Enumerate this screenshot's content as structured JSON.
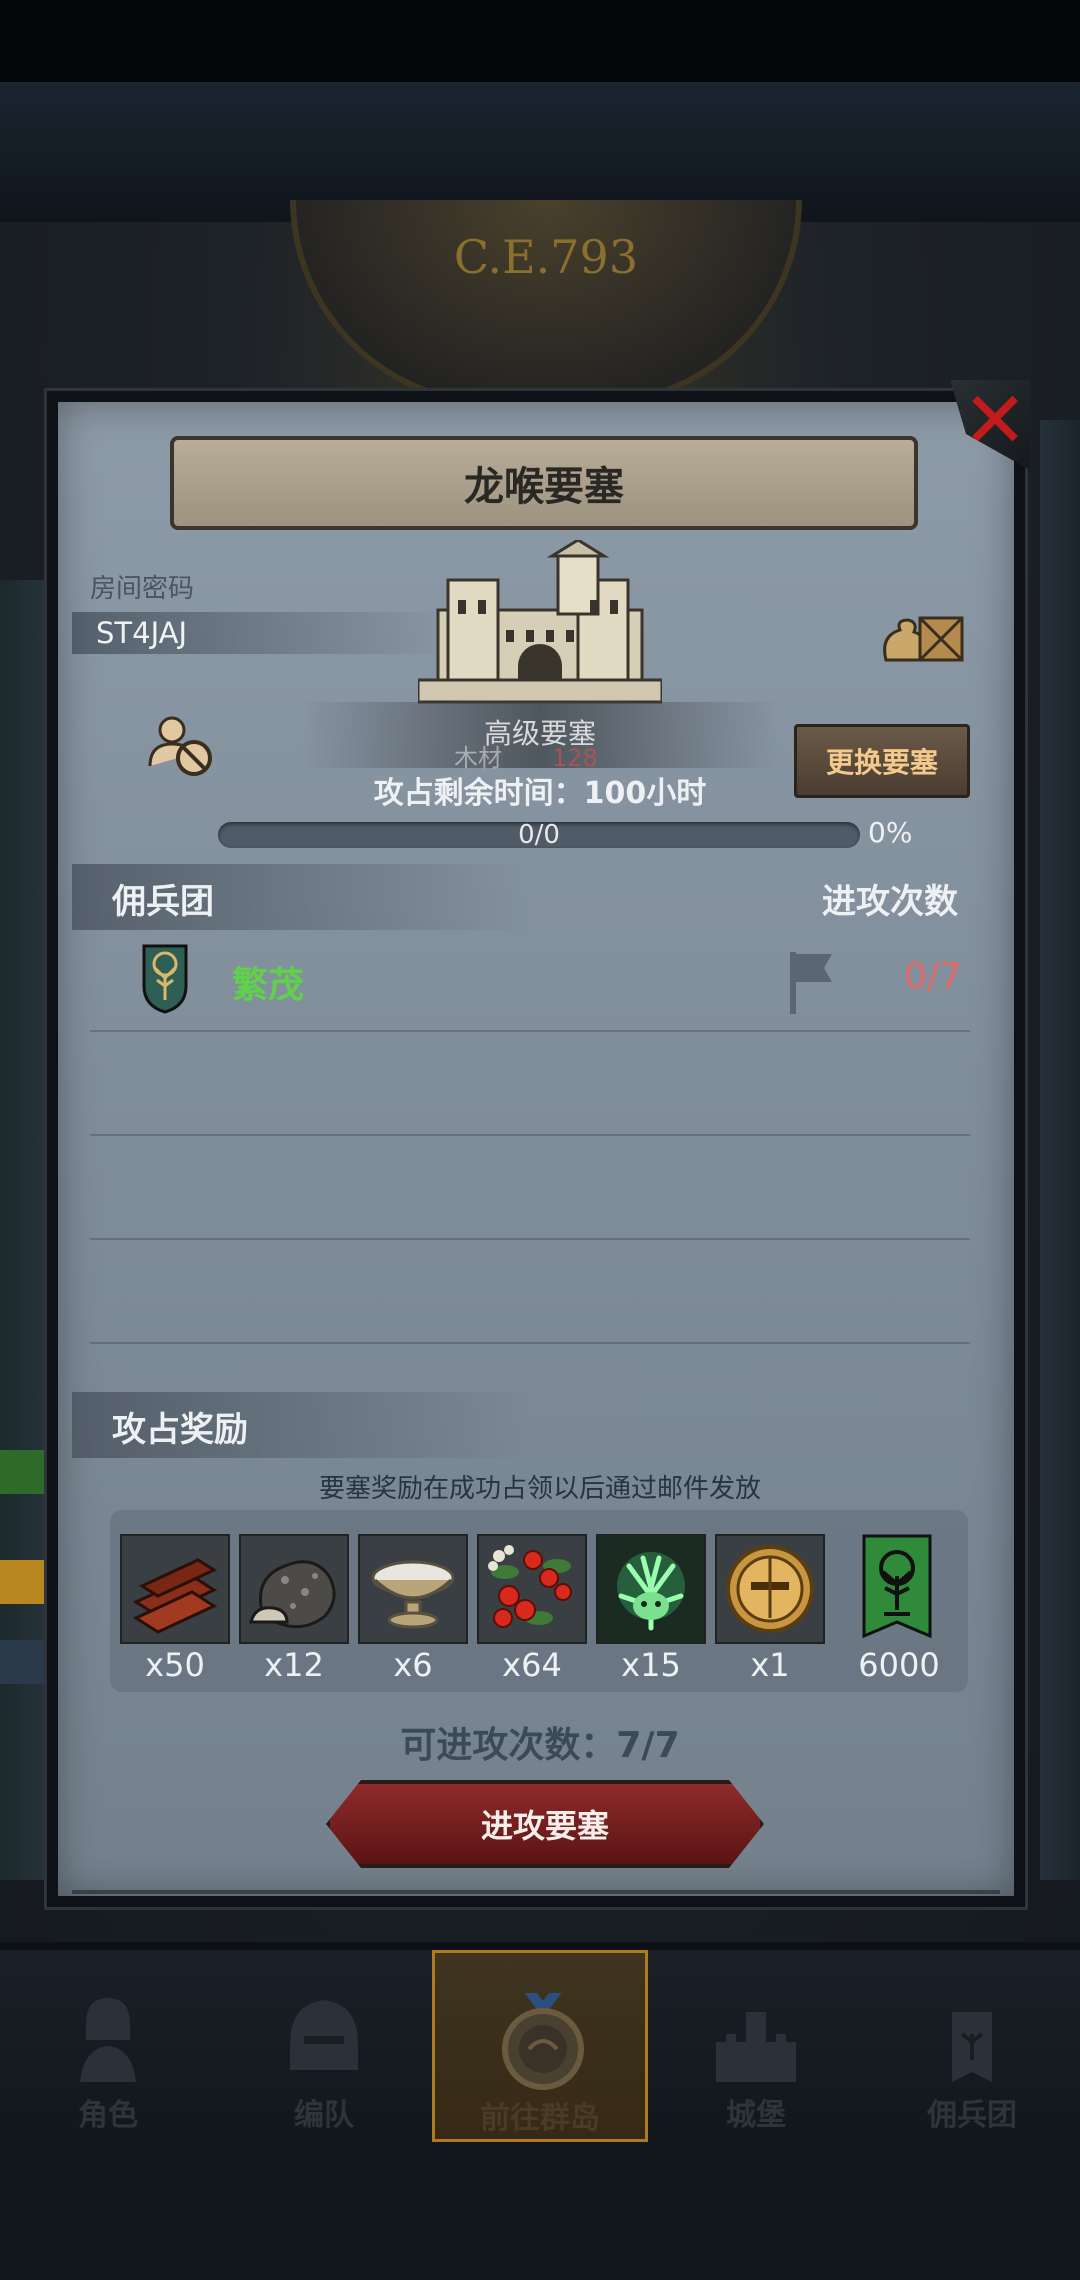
{
  "background": {
    "era": "C.E.793"
  },
  "modal": {
    "title": "龙喉要塞",
    "close_icon": "close-x-icon",
    "room": {
      "label": "房间密码",
      "code": "ST4JAJ"
    },
    "fortress": {
      "tier": "高级要塞",
      "cost_label": "木材",
      "cost_value": "128"
    },
    "change_button": "更换要塞",
    "time_left": "攻占剩余时间：100小时",
    "progress": {
      "text": "0/0",
      "percent_label": "0%",
      "value": 0
    },
    "mercenary_section": {
      "title": "佣兵团",
      "attacks_header": "进攻次数",
      "rows": [
        {
          "name": "繁茂",
          "attacks": "0/7",
          "icon": "tree-shield-icon"
        }
      ]
    },
    "rewards_section": {
      "title": "攻占奖励",
      "note": "要塞奖励在成功占领以后通过邮件发放",
      "items": [
        {
          "icon": "wood-logs-icon",
          "qty": "x50"
        },
        {
          "icon": "ore-rock-icon",
          "qty": "x12"
        },
        {
          "icon": "silver-bowl-icon",
          "qty": "x6"
        },
        {
          "icon": "berries-icon",
          "qty": "x64"
        },
        {
          "icon": "green-spirit-icon",
          "qty": "x15"
        },
        {
          "icon": "golden-helmet-icon",
          "qty": "x1"
        },
        {
          "icon": "tree-banner-icon",
          "qty": "6000"
        }
      ]
    },
    "attacks_available": "可进攻次数：7/7",
    "attack_button": "进攻要塞"
  },
  "bottom_nav": [
    {
      "label": "角色",
      "icon": "knight-icon"
    },
    {
      "label": "编队",
      "icon": "helmet-icon"
    },
    {
      "label": "前往群岛",
      "icon": "compass-icon",
      "active": true
    },
    {
      "label": "城堡",
      "icon": "castle-icon"
    },
    {
      "label": "佣兵团",
      "icon": "mercenary-icon"
    }
  ],
  "colors": {
    "accent_green": "#5fd24a",
    "accent_red": "#e36a6a",
    "close_red": "#c21b1b",
    "attack_button": "#8f2a2a",
    "change_button_text": "#f3c98c"
  }
}
